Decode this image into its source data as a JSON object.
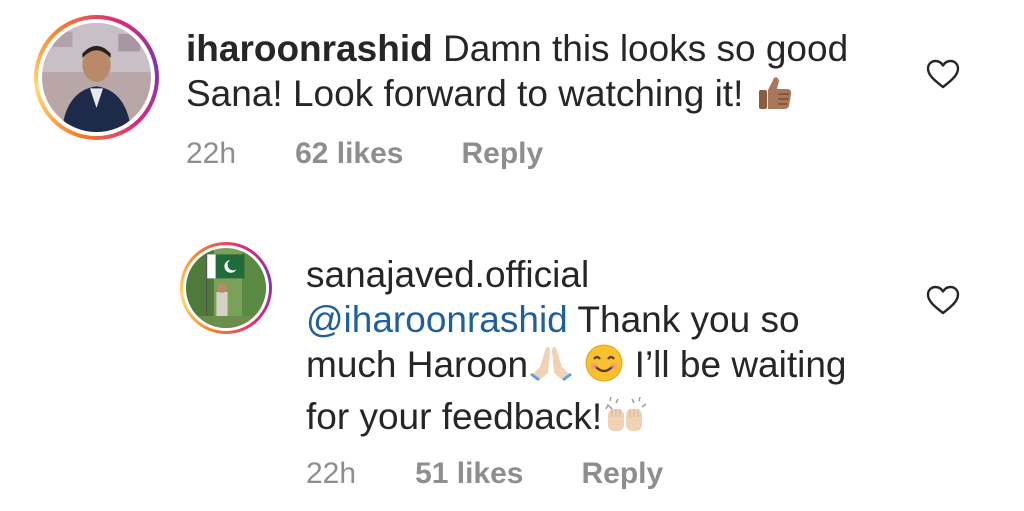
{
  "comments": [
    {
      "username": "iharoonrashid",
      "text_line1": "Damn this looks so good",
      "text_line2": "Sana! Look forward to watching it!",
      "time": "22h",
      "likes": "62 likes",
      "reply": "Reply",
      "emoji": "thumbs-up"
    },
    {
      "username": "sanajaved.official",
      "mention": "@iharoonrashid",
      "text_line1": "Thank you so",
      "text_line2a": "much Haroon",
      "text_line2b": "I’ll be waiting",
      "text_line3": "for your feedback!",
      "time": "22h",
      "likes": "51 likes",
      "reply": "Reply",
      "emojis": [
        "folded-hands",
        "smiling-face",
        "raising-hands"
      ]
    }
  ],
  "colors": {
    "text": "#262626",
    "muted": "#8e8e8e",
    "mention": "#1f5f9c",
    "story_ring_start": "#f58529",
    "story_ring_end": "#dd2a7b"
  }
}
